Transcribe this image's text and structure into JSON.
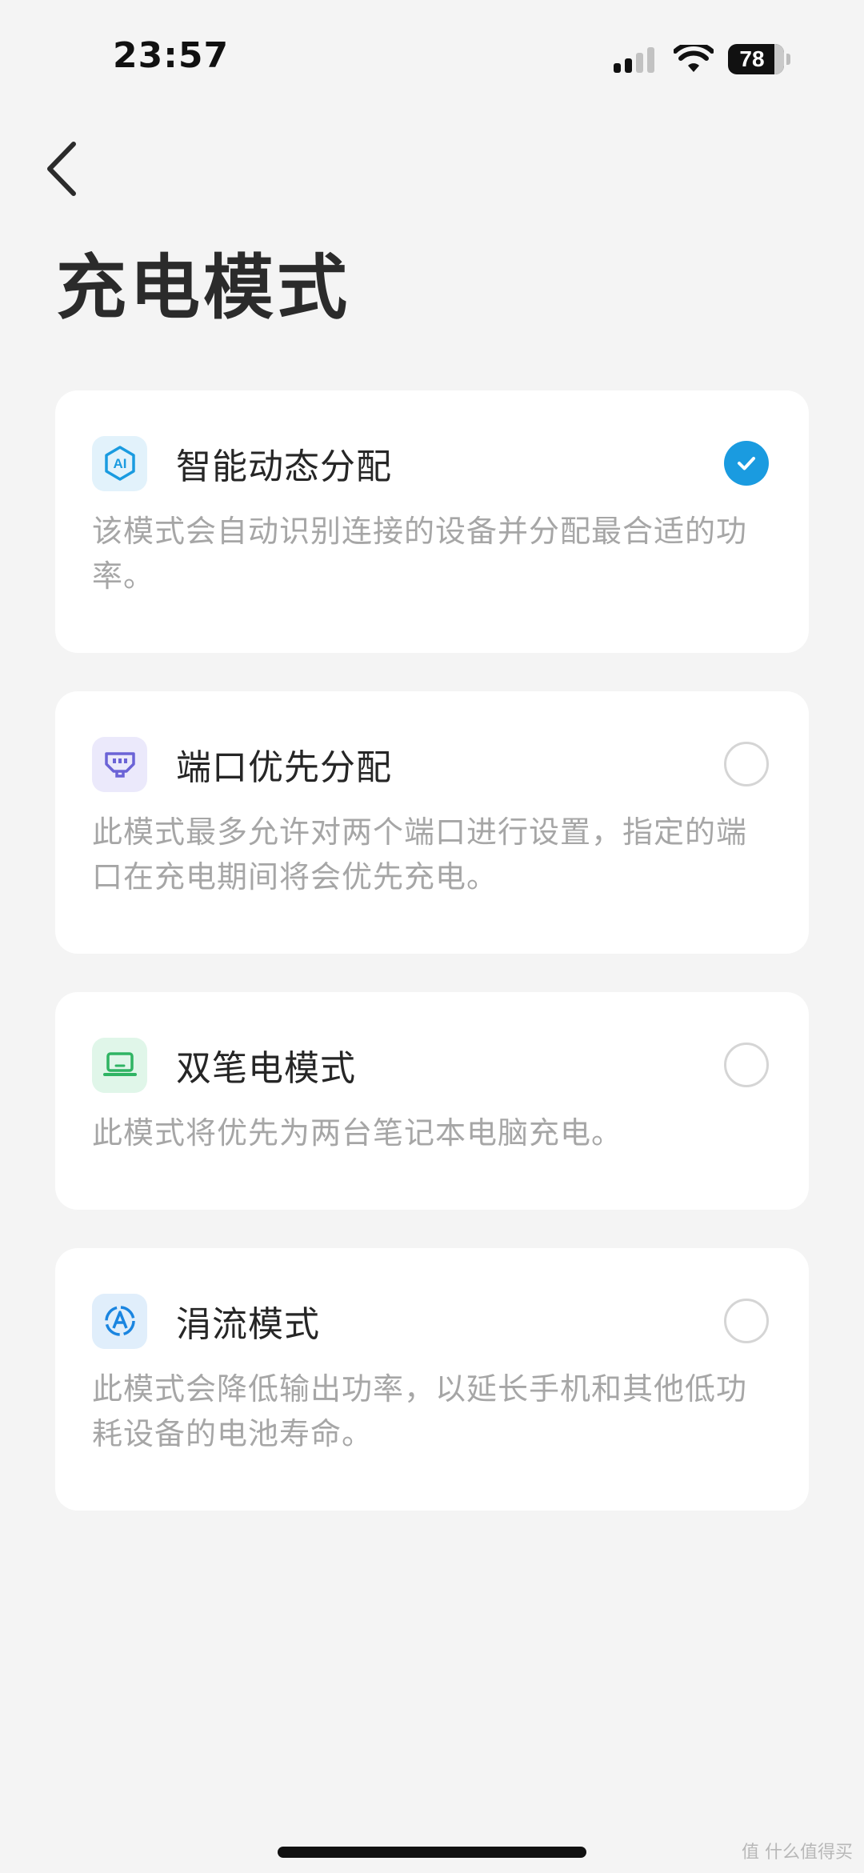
{
  "status_bar": {
    "time": "23:57",
    "battery": "78"
  },
  "header": {
    "back_icon": "chevron-left-icon",
    "title": "充电模式"
  },
  "modes": [
    {
      "icon": "ai-icon",
      "label": "智能动态分配",
      "description": "该模式会自动识别连接的设备并分配最合适的功率。",
      "selected": true
    },
    {
      "icon": "port-icon",
      "label": "端口优先分配",
      "description": "此模式最多允许对两个端口进行设置，指定的端口在充电期间将会优先充电。",
      "selected": false
    },
    {
      "icon": "laptop-icon",
      "label": "双笔电模式",
      "description": "此模式将优先为两台笔记本电脑充电。",
      "selected": false
    },
    {
      "icon": "trickle-icon",
      "label": "涓流模式",
      "description": "此模式会降低输出功率，以延长手机和其他低功耗设备的电池寿命。",
      "selected": false
    }
  ],
  "colors": {
    "accent": "#1a9be0",
    "background": "#f4f4f4",
    "card": "#ffffff",
    "description_text": "#a6a6a6"
  },
  "watermark": "值 什么值得买"
}
